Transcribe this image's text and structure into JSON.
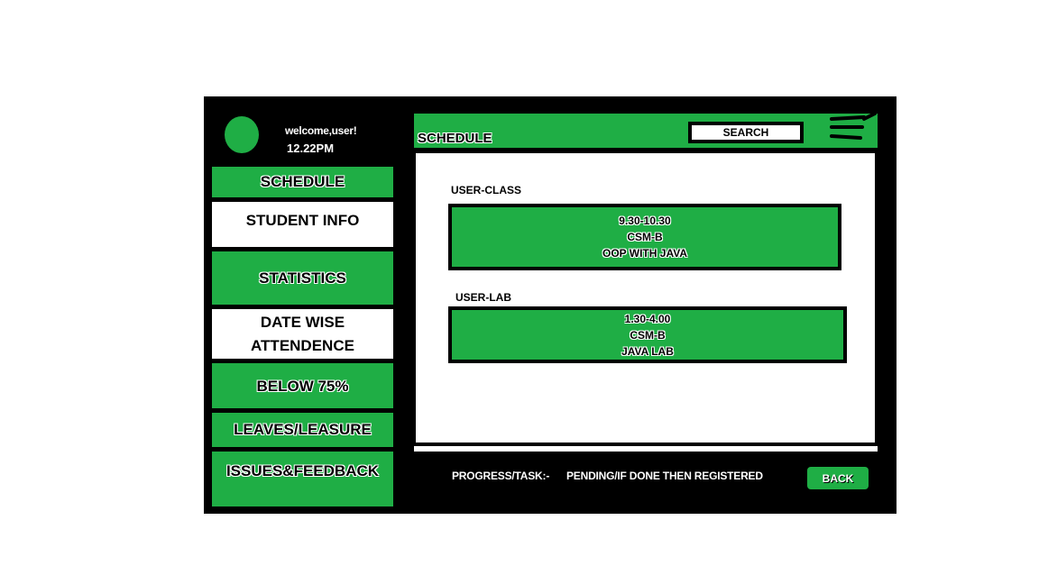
{
  "header": {
    "welcome_text": "welcome,user!",
    "time": "12.22PM"
  },
  "sidebar": {
    "items": [
      {
        "label": "SCHEDULE"
      },
      {
        "label": "STUDENT INFO"
      },
      {
        "label": "STATISTICS"
      },
      {
        "label": "DATE WISE\nATTENDENCE"
      },
      {
        "label": "BELOW 75%"
      },
      {
        "label": "LEAVES/LEASURE"
      },
      {
        "label": "ISSUES&FEEDBACK"
      }
    ]
  },
  "topbar": {
    "title": "SCHEDULE",
    "search_label": "SEARCH",
    "menu_icon": "hamburger-menu-icon"
  },
  "main": {
    "class_section": {
      "label": "USER-CLASS",
      "time": "9.30-10.30",
      "section": "CSM-B",
      "subject": "OOP WITH JAVA"
    },
    "lab_section": {
      "label": "USER-LAB",
      "time": "1.30-4.00",
      "section": "CSM-B",
      "subject": "JAVA LAB"
    }
  },
  "footer": {
    "progress_label": "PROGRESS/TASK:-",
    "progress_value": "PENDING/IF DONE THEN REGISTERED",
    "back_label": "BACK"
  },
  "colors": {
    "accent": "#1fae45",
    "background": "#000000",
    "panel": "#ffffff"
  }
}
